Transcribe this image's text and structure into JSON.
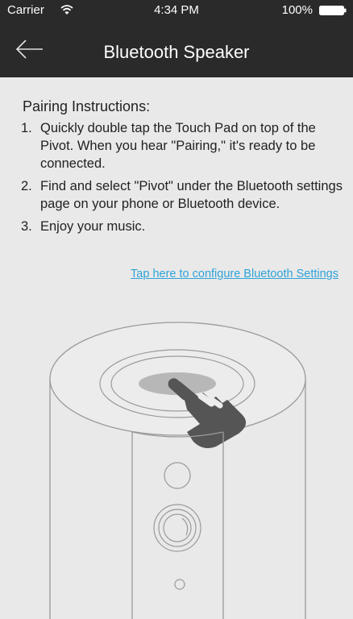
{
  "status_bar": {
    "carrier": "Carrier",
    "time": "4:34 PM",
    "battery_percent": "100%"
  },
  "nav": {
    "title": "Bluetooth Speaker",
    "back_icon": "arrow-left-icon"
  },
  "instructions": {
    "heading": "Pairing Instructions:",
    "steps": [
      {
        "number": "1.",
        "text": "Quickly double tap the Touch Pad on top of the Pivot. When you hear \"Pairing,\" it's ready to be connected."
      },
      {
        "number": "2.",
        "text": "Find and select \"Pivot\" under the Bluetooth settings page on your phone or Bluetooth device."
      },
      {
        "number": "3.",
        "text": "Enjoy your music."
      }
    ]
  },
  "link": {
    "label": "Tap here to configure Bluetooth Settings"
  },
  "colors": {
    "bar_background": "#2a2a2a",
    "page_background": "#e9e9e9",
    "link": "#2ea3d8",
    "text": "#222222"
  }
}
